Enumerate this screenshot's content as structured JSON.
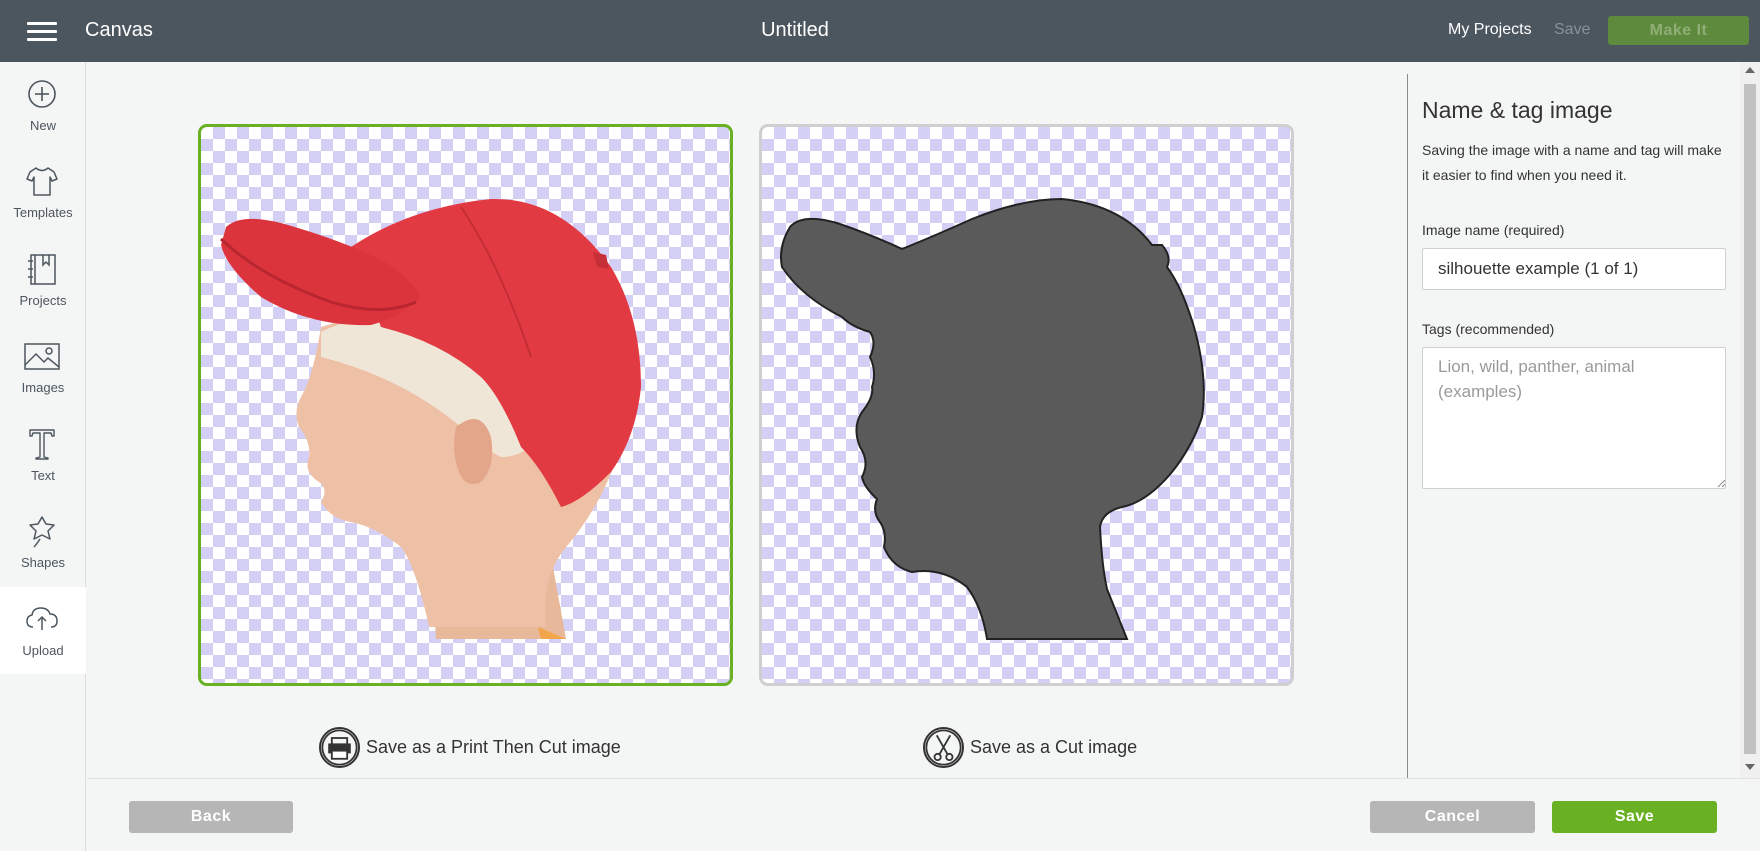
{
  "topbar": {
    "app_title": "Canvas",
    "doc_title": "Untitled",
    "my_projects": "My Projects",
    "save": "Save",
    "make_it": "Make It"
  },
  "nav": {
    "items": [
      {
        "label": "New",
        "icon": "plus-circle-icon"
      },
      {
        "label": "Templates",
        "icon": "tshirt-icon"
      },
      {
        "label": "Projects",
        "icon": "notebook-icon"
      },
      {
        "label": "Images",
        "icon": "image-icon"
      },
      {
        "label": "Text",
        "icon": "text-t-icon"
      },
      {
        "label": "Shapes",
        "icon": "shapes-icon"
      },
      {
        "label": "Upload",
        "icon": "cloud-upload-icon",
        "active": true
      }
    ]
  },
  "options": {
    "print_then_cut": "Save as a Print Then Cut image",
    "cut": "Save as a Cut image"
  },
  "sidebar": {
    "title": "Name & tag image",
    "description": "Saving the image with a name and tag will make it easier to find when you need it.",
    "name_label": "Image name (required)",
    "name_value": "silhouette example (1 of 1)",
    "tags_label": "Tags (recommended)",
    "tags_placeholder": "Lion, wild, panther, animal (examples)",
    "tags_value": ""
  },
  "footer": {
    "back": "Back",
    "cancel": "Cancel",
    "save": "Save"
  },
  "colors": {
    "topbar": "#4c565e",
    "accent_green": "#6ab023",
    "disabled_make_it": "#5e8a3e",
    "checker": "#d4d0f5",
    "silhouette": "#5a5a5a",
    "cap_red": "#e23a42"
  }
}
